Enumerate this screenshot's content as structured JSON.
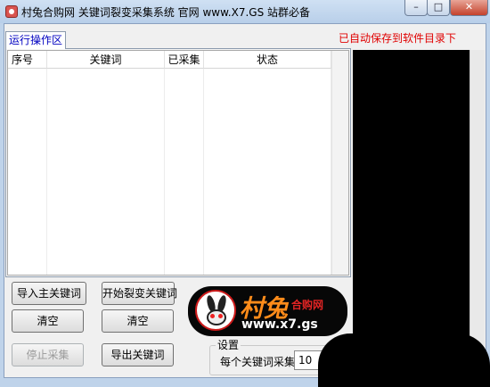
{
  "window": {
    "title": "村兔合购网 关键词裂变采集系统 官网 www.X7.GS 站群必备",
    "minimize": "–",
    "maximize": "□",
    "close": "✕",
    "icon": "app-rabbit-icon"
  },
  "tab": {
    "label": "运行操作区"
  },
  "notice": {
    "autosave": "已自动保存到软件目录下",
    "color": "#e00000"
  },
  "table": {
    "columns": [
      "序号",
      "关键词",
      "已采集",
      "状态"
    ],
    "rows": []
  },
  "buttons": {
    "import_main": "导入主关键词",
    "start_split": "开始裂变关键词",
    "clear_left": "清空",
    "clear_right": "清空",
    "stop": "停止采集",
    "export": "导出关键词"
  },
  "logo": {
    "main": "村兔",
    "sub": "合购网",
    "url": "www.x7.gs"
  },
  "settings": {
    "title": "设置",
    "per_keyword_label": "每个关键词采集",
    "per_keyword_value": "10"
  }
}
